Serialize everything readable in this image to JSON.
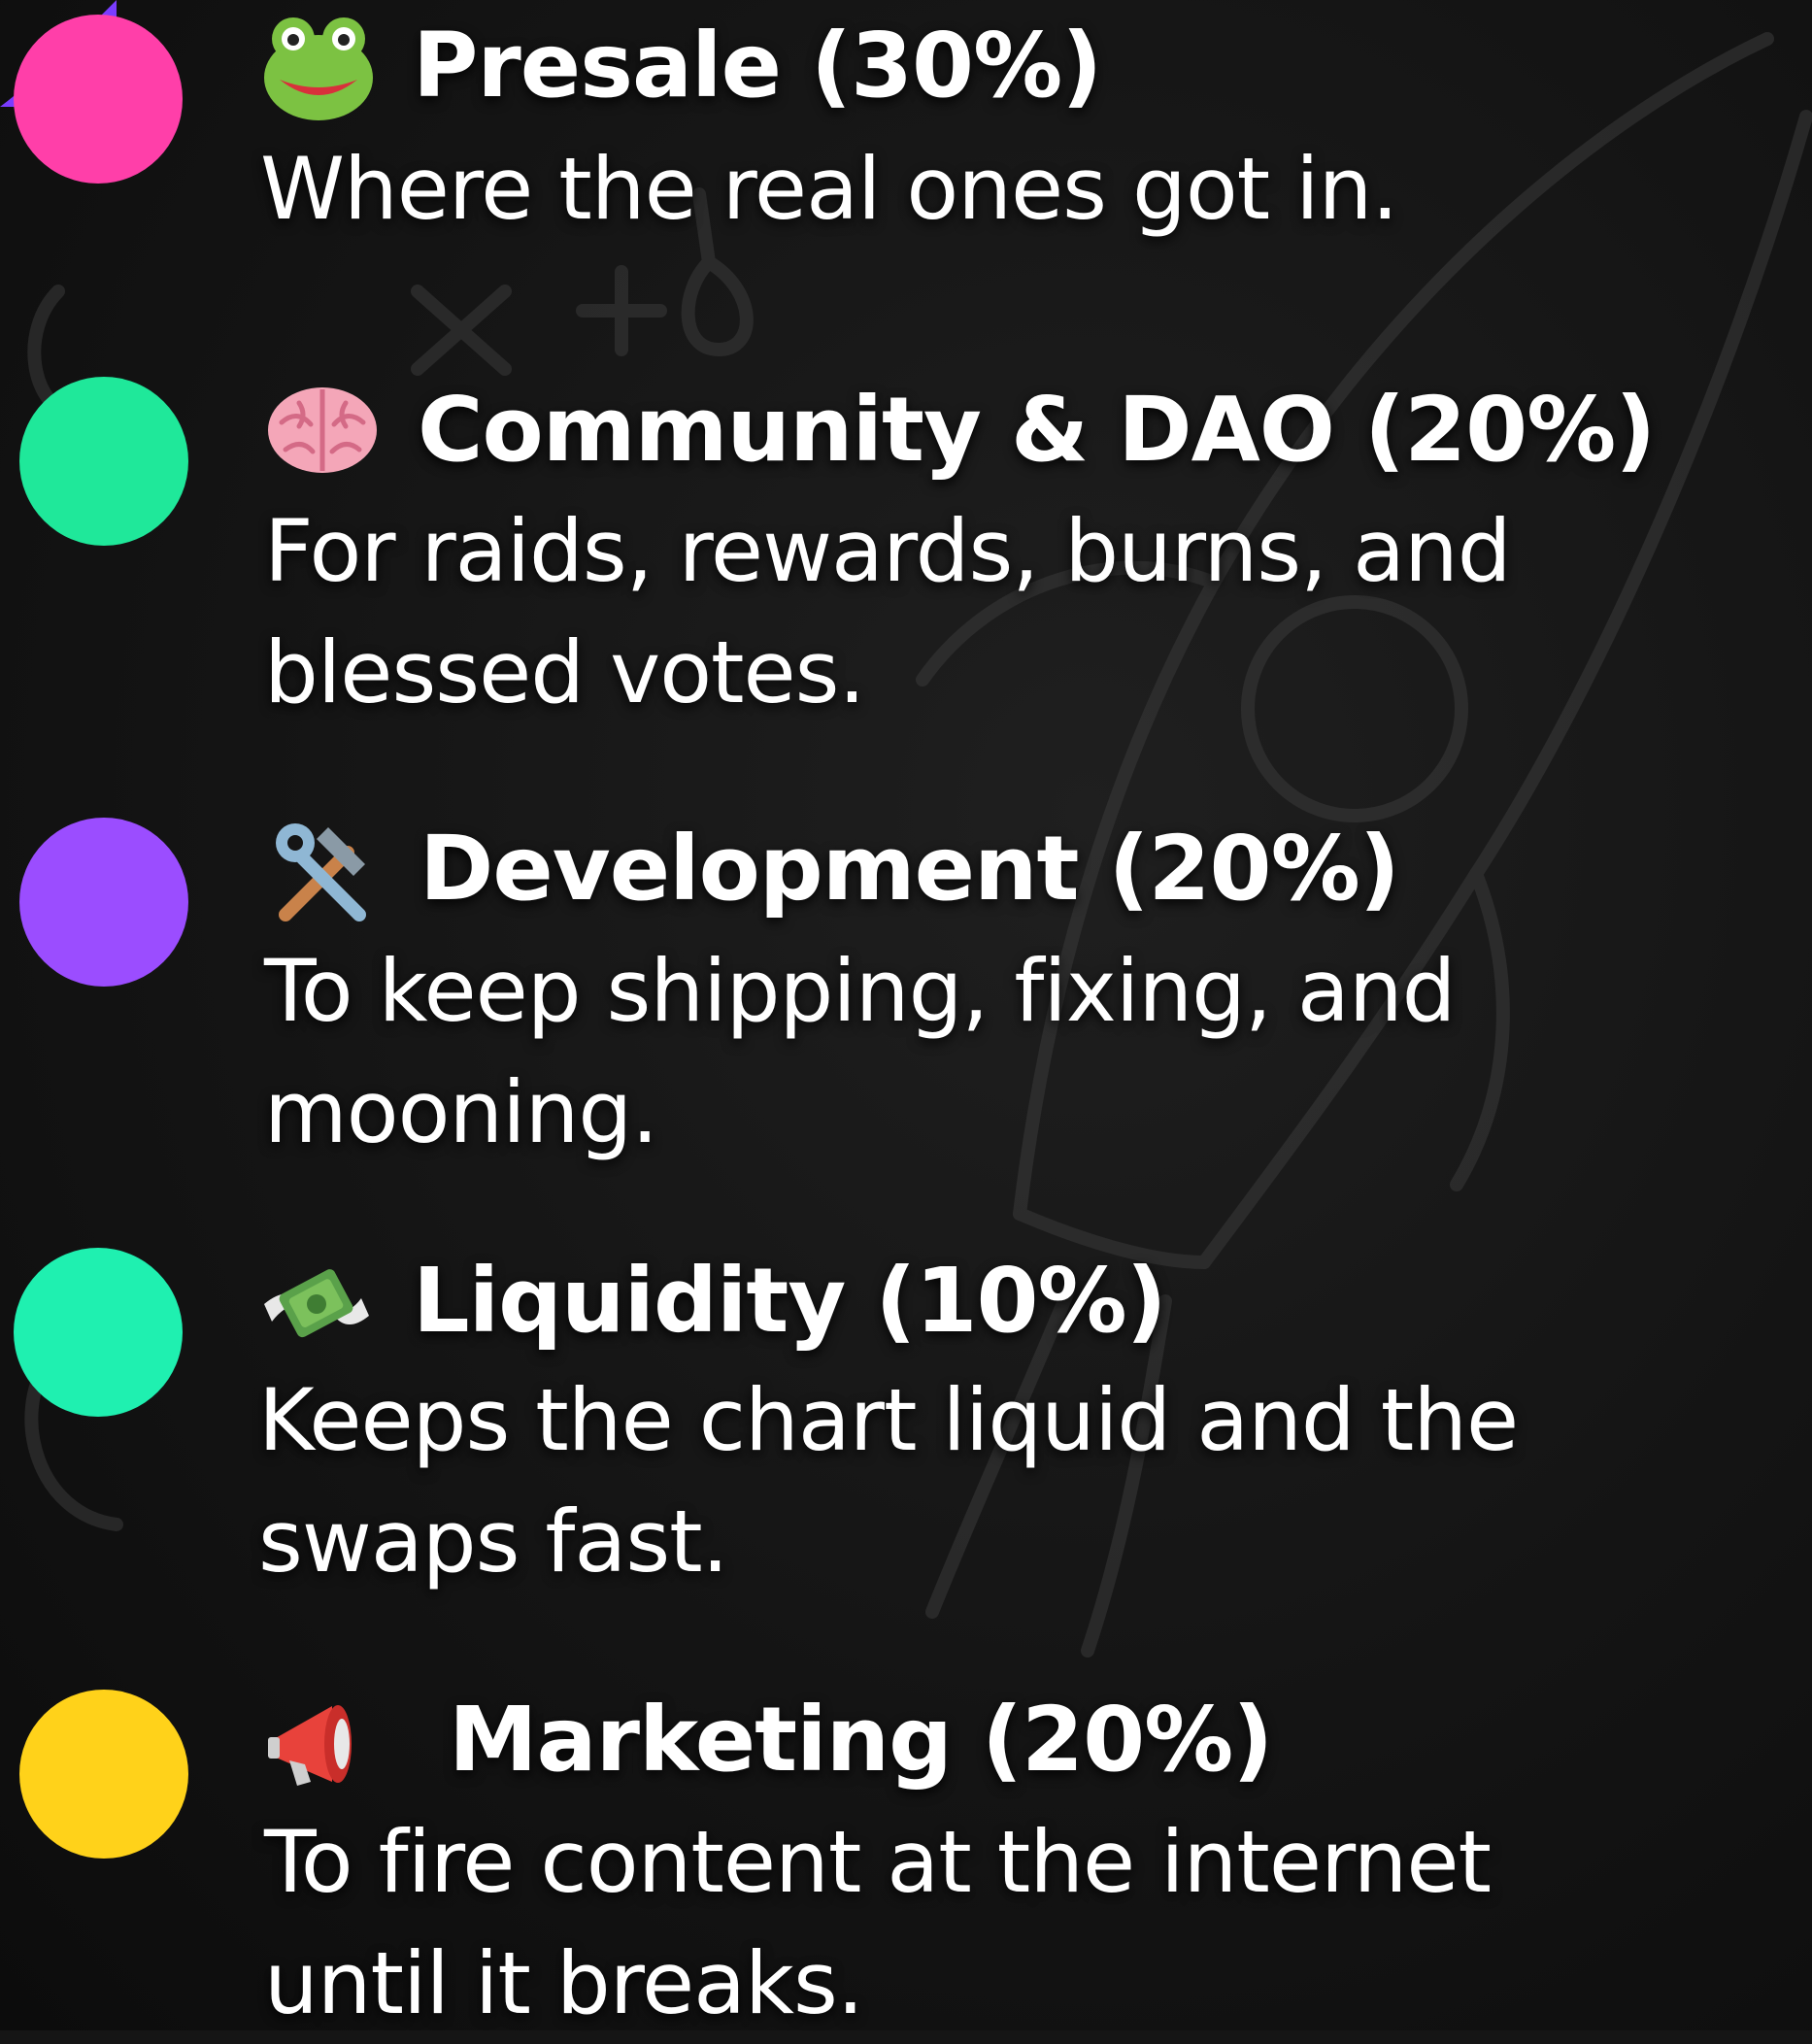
{
  "colors": {
    "background": "#151515",
    "text": "#ffffff",
    "presale": "#ff3fa9",
    "community": "#1fe89a",
    "development": "#9b4dff",
    "liquidity": "#1ff0b0",
    "marketing": "#ffd21a"
  },
  "items": [
    {
      "icon": "frog-emoji-icon",
      "title": "Presale (30%)",
      "desc_lines": [
        "Where the real ones got in."
      ]
    },
    {
      "icon": "brain-emoji-icon",
      "title": "Community & DAO (20%)",
      "desc_lines": [
        "For raids, rewards, burns, and",
        "blessed votes."
      ]
    },
    {
      "icon": "hammer-wrench-emoji-icon",
      "title": "Development (20%)",
      "desc_lines": [
        "To keep shipping, fixing, and",
        "mooning."
      ]
    },
    {
      "icon": "money-wings-emoji-icon",
      "title": "Liquidity (10%)",
      "desc_lines": [
        "Keeps the chart liquid and the",
        "swaps fast."
      ]
    },
    {
      "icon": "megaphone-emoji-icon",
      "title": "Marketing (20%)",
      "desc_lines": [
        "To fire content at the internet",
        "until it breaks."
      ]
    }
  ]
}
